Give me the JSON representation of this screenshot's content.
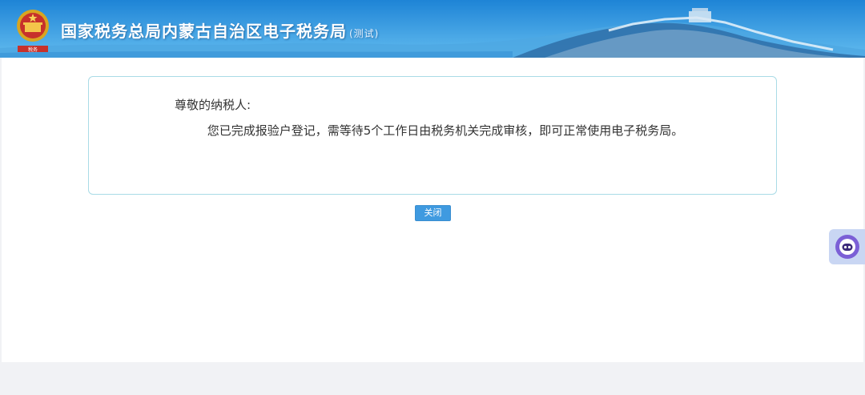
{
  "header": {
    "title": "国家税务总局内蒙古自治区电子税务局",
    "trial_label": "(测试)",
    "logo_icon": "national-emblem-icon"
  },
  "notice": {
    "salutation": "尊敬的纳税人:",
    "message": "您已完成报验户登记，需等待5个工作日由税务机关完成审核，即可正常使用电子税务局。"
  },
  "actions": {
    "close_label": "关闭"
  },
  "widget": {
    "icon": "customer-service-robot-icon",
    "accent": "#7b5fd6"
  },
  "colors": {
    "header_blue": "#1d83d4",
    "button_blue": "#3f9ae0",
    "box_border": "#a9dbe6"
  }
}
